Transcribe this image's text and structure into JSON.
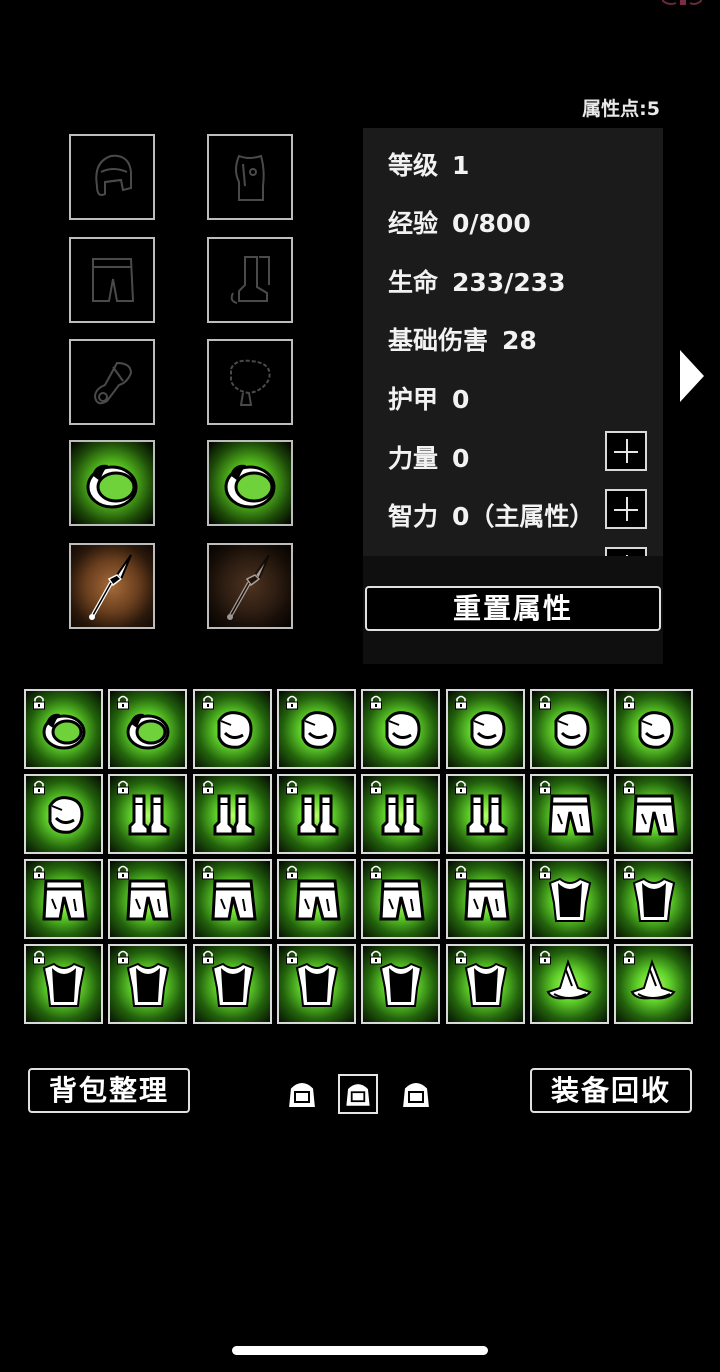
{
  "header": {
    "attr_points": "属性点:5"
  },
  "equipment": [
    {
      "slot": "helmet",
      "state": "empty"
    },
    {
      "slot": "armor",
      "state": "empty"
    },
    {
      "slot": "pants",
      "state": "empty"
    },
    {
      "slot": "boots",
      "state": "empty"
    },
    {
      "slot": "bracer",
      "state": "empty"
    },
    {
      "slot": "necklace",
      "state": "empty"
    },
    {
      "slot": "ring-1",
      "state": "equipped",
      "rarity_color": "#5fd02a"
    },
    {
      "slot": "ring-2",
      "state": "equipped",
      "rarity_color": "#5fd02a"
    },
    {
      "slot": "weapon-1",
      "state": "equipped",
      "rarity_color": "#8a5630"
    },
    {
      "slot": "weapon-2",
      "state": "equipped-dim",
      "rarity_color": "#3b2617"
    }
  ],
  "stats": {
    "level": {
      "label": "等级",
      "value": "1"
    },
    "exp": {
      "label": "经验",
      "value": "0/800"
    },
    "hp": {
      "label": "生命",
      "value": "233/233"
    },
    "base_damage": {
      "label": "基础伤害",
      "value": "28"
    },
    "armor": {
      "label": "护甲",
      "value": "0"
    },
    "strength": {
      "label": "力量",
      "value": "0"
    },
    "intellect": {
      "label": "智力",
      "value": "0（主属性）"
    }
  },
  "reset_button": "重置属性",
  "inventory": {
    "rows": [
      [
        "ring",
        "ring",
        "glove",
        "glove",
        "glove",
        "glove",
        "glove",
        "glove"
      ],
      [
        "glove",
        "boots",
        "boots",
        "boots",
        "boots",
        "boots",
        "pants",
        "pants"
      ],
      [
        "pants",
        "pants",
        "pants",
        "pants",
        "pants",
        "pants",
        "armor",
        "armor"
      ],
      [
        "armor",
        "armor",
        "armor",
        "armor",
        "armor",
        "armor",
        "hat",
        "hat"
      ]
    ],
    "locked": true,
    "rarity_color": "#5fd02a"
  },
  "bottom": {
    "sort_button": "背包整理",
    "recycle_button": "装备回收",
    "pages": 3,
    "active_page": 2
  },
  "colors": {
    "green_glow": "#5fd02a",
    "panel_bg": "#1b1b1b"
  }
}
